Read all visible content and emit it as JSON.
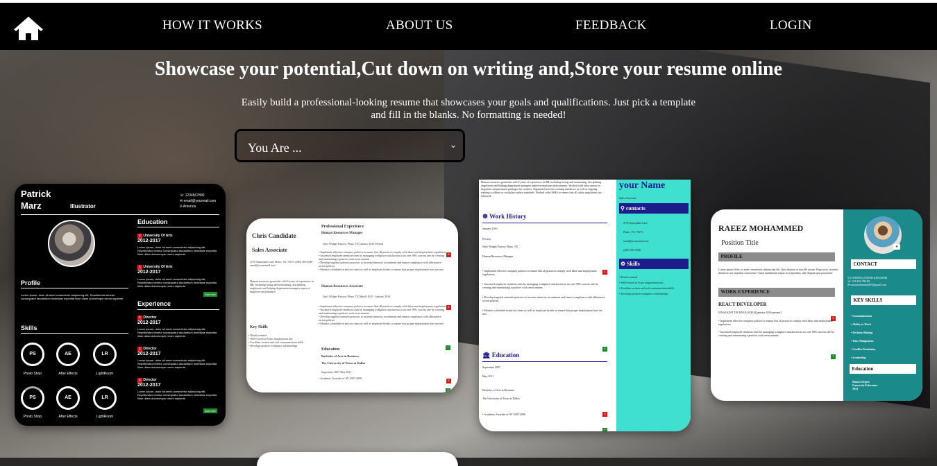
{
  "nav": {
    "links": [
      "HOW IT WORKS",
      "ABOUT US",
      "FEEDBACK",
      "LOGIN"
    ]
  },
  "hero": {
    "headline": "Showcase your potential,Cut down on writing and,Store your resume online",
    "subtext": "Easily build a professional-looking resume that showcases your goals and qualifications. Just pick a template and fill in the blanks. No formatting is needed!",
    "select_value": "You Are ..."
  },
  "cards": {
    "c1": {
      "first_name": "Patrick",
      "last_name": "Marz",
      "role": "Illustrator",
      "phone": "1234567890",
      "email": "email@yourmail.com",
      "location": "America",
      "education_title": "Education",
      "edu": [
        {
          "school": "University Of Arts",
          "years": "2012-2017"
        },
        {
          "school": "University Of Arts",
          "years": "2012-2017"
        }
      ],
      "profile_title": "Profile",
      "experience_title": "Experience",
      "exp": [
        {
          "title": "Director",
          "years": "2012-2017"
        },
        {
          "title": "Director",
          "years": "2012-2017"
        },
        {
          "title": "Director",
          "years": "2012-2017"
        }
      ],
      "skills_title": "Skills",
      "skills": [
        {
          "abbr": "PS",
          "name": "Photo Shop"
        },
        {
          "abbr": "AE",
          "name": "After Effects"
        },
        {
          "abbr": "LR",
          "name": "LightRoom"
        },
        {
          "abbr": "PS",
          "name": "Photo Shop"
        },
        {
          "abbr": "AE",
          "name": "After Effects"
        },
        {
          "abbr": "LR",
          "name": "LightRoom"
        }
      ],
      "add_new": "Add new",
      "lorem": "Lorem Ipsum, dolor sit amet consectetur adipisicing elit. Repellendus tenetur consequatur laudantium molestiae expedita illum ullam doloremque rerum sapiente."
    },
    "c2": {
      "name": "Chris Candidate",
      "title": "Sales Associate",
      "address": "4759 Sunnydale Lane Plano, TX, 75071 (469) 385-2948 email@youremail.com",
      "summary": "Human resources generalist with 8 years of experience in HR, including hiring and terminating, disciplining employees and helping department managers improve employee performance.",
      "exp_title": "Professional Experience",
      "job1": "Human Resources Manager",
      "job1_meta": "Jim's Widget Factory, Plano, TX January 2016 Present",
      "job2": "Human Resources Associate",
      "job2_meta": "Jim's Widget Factory, Plano, TX March 2015 - January 2016",
      "bullets": [
        "Implement effective company policies to ensure that all practices comply with labor and employment regulations",
        "Increased employee retention rates by managing workplace satisfaction to an over 90% success rate by creating and maintaining a positive work environment",
        "Develop targeted outreach practices to increase minority recruitment and ensure compliance with affirmative action policies",
        "Monitor scheduled in and out times as well as employee breaks to ensure that proper employment laws are met"
      ],
      "skills_title": "Key Skills",
      "skills": [
        "Detail oriented",
        "Well-versed in Texas employment law",
        "Excellent written and oral communication skills",
        "Develops positive workplace relationships"
      ],
      "edu_title": "Education",
      "degree": "Bachelor of Arts in Business",
      "school": "The University of Texas at Dallas",
      "edu_dates": "September 2007 May 2011",
      "honor": "Academic Awardee of AY 2007-2008"
    },
    "c3": {
      "intro": "Human resources generalist with 8 years of experience in HR, including hiring and terminating, disciplining employees and helping department managers improve employee performance. Worked with labor unions to negotiate compensation packages for workers. Organized new hire training initiatives as well as ongoing training to adhere to workplace safety standards. Worked with OSHA to ensure that all safety regulations are followed.",
      "work_title": "Work History",
      "work_date": "January 2016",
      "work_present": "Present",
      "work_company": "Jim's Widget Factory Plano, TX",
      "work_role": "Human Resources Manager",
      "bullets": [
        "Implement effective company policies to ensure that all practices comply with labor and employment regulations",
        "Increased employee retention rates by managing workplace satisfaction to an over 90% success rate by creating and maintaining a positive work environment",
        "Develop targeted outreach practices to increase minority recruitment and ensure compliance with affirmative action policies",
        "Monitor scheduled in and out times as well as employee breaks to ensure that proper employment laws are met"
      ],
      "edu_title": "Education",
      "edu_start": "September 2007",
      "edu_end": "May 2011",
      "degree": "Bachelor of Arts in Business",
      "school": "The University of Texas at Dallas",
      "honor": "Academic Awardee of AY 2007-2008",
      "name": "your Name",
      "role": "Sales Associate",
      "contacts_title": "contacts",
      "contacts": [
        "4759 Sunnydale Lane",
        "Plano, TX, 75071",
        "email@youremail.com",
        "(469) 385-2948"
      ],
      "skills_title": "Skills",
      "skills": [
        "Detail oriented",
        "Well-versed in Texas employment law",
        "Excellent written and oral communication skills",
        "Develops positive workplace relationships"
      ]
    },
    "c4": {
      "name": "RAEEZ MOHAMMED",
      "position": "Position Title",
      "profile_title": "PROFILE",
      "profile_text": "Lorem ipsum dolor sit amet consectetur adipisicing elit. Quo aliquam at non illo ipsum. Fuga iusto, maiores distinctio aut expedita consectetur? Amet laudantium itaque in temporibus odit eliquam ipsa possimus!",
      "work_title": "WORK EXPERIENCE",
      "job": "REACT DEVELOPER",
      "job_meta": "[ENALIGHT TECHNOLOGIES][january 2016-present]",
      "bullets": [
        "Implement effective company policies to ensure that all practices comply with labor and employment regulations",
        "Increased employee retention rates by managing workplace satisfaction to an over 90% success rate by creating and maintaining a positive work environment"
      ],
      "contact_title": "CONTACT",
      "contact": [
        "LONDON,UNITED KINGDOM",
        "123-456-789-00",
        "raeezmohammed97@gmail.com"
      ],
      "skills_title": "KEY SKILLS",
      "skills": [
        "Communication",
        "Ability to Work",
        "Decision Making",
        "Time Mangement",
        "Conflict Resolution",
        "Leadership"
      ],
      "edu_title": "Education",
      "degree": "Master Degree",
      "school": "University Education",
      "year": "2014"
    }
  },
  "colors": {
    "nav_bg": "#000000",
    "teal": "#1b8a8a",
    "aqua": "#3fe0d0",
    "navy": "#1c1c8c",
    "red": "#d71b1b",
    "green": "#1f8b2c"
  }
}
